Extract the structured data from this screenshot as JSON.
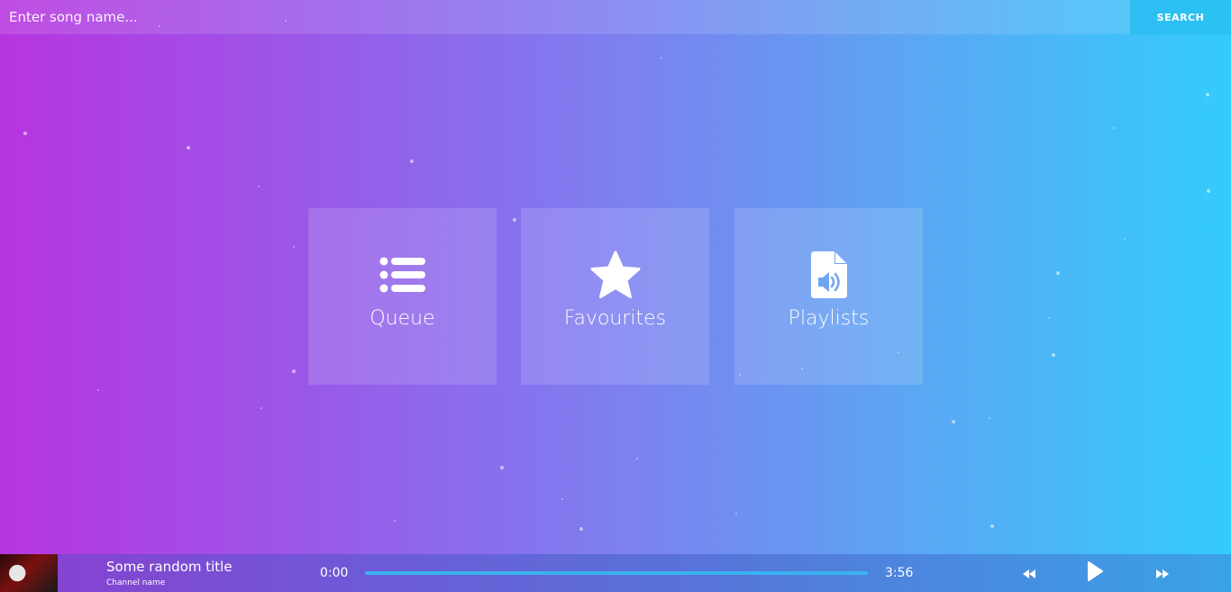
{
  "search": {
    "placeholder": "Enter song name...",
    "button_label": "SEARCH"
  },
  "tiles": [
    {
      "label": "Queue",
      "icon": "list-icon"
    },
    {
      "label": "Favourites",
      "icon": "star-icon"
    },
    {
      "label": "Playlists",
      "icon": "audio-file-icon"
    }
  ],
  "player": {
    "title": "Some random title",
    "channel": "Channel name",
    "current_time": "0:00",
    "total_time": "3:56",
    "progress": 0,
    "icons": {
      "rewind": "rewind-icon",
      "play": "play-icon",
      "fast_forward": "fast-forward-icon"
    }
  },
  "colors": {
    "gradient_start": "#b735e0",
    "gradient_end": "#33ccfb",
    "progress_track": "#39b2ee"
  }
}
